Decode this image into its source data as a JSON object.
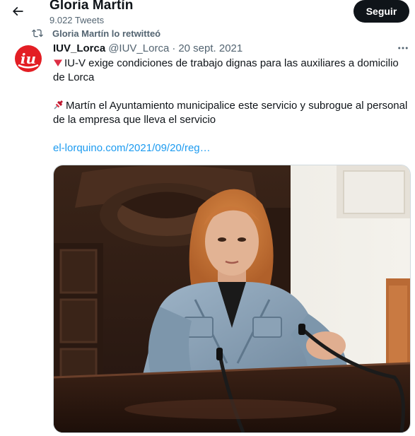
{
  "header": {
    "title": "Gloria Martín",
    "tweet_count": "9.022 Tweets",
    "follow_label": "Seguir"
  },
  "retweet": {
    "label": "Gloria Martín lo retwitteó"
  },
  "tweet": {
    "author_name": "IUV_Lorca",
    "handle": "@IUV_Lorca",
    "separator": "·",
    "date": "20 sept. 2021",
    "paragraph_1": "IU-V exige condiciones de trabajo dignas para las auxiliares a domicilio de Lorca",
    "paragraph_2": "Martín el Ayuntamiento municipalice este servicio y subrogue al personal de la empresa que lleva el servicio",
    "link_text": "el-lorquino.com/2021/09/20/reg…",
    "avatar_text": "iu"
  },
  "icons": {
    "back": "arrow-left-icon",
    "retweet": "retweet-icon",
    "more": "more-horizontal-icon",
    "bullet_1": "red-triangle-down-emoji",
    "bullet_2": "pushpin-emoji"
  },
  "colors": {
    "accent_link": "#1d9bf0",
    "follow_bg": "#0f1419",
    "muted_text": "#536471",
    "avatar_red": "#e31e24"
  }
}
